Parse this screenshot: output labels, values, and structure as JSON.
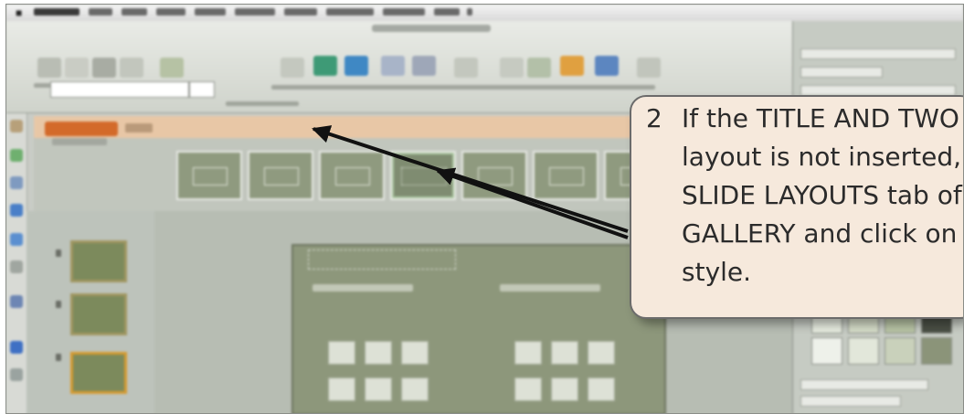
{
  "app": {
    "menu_icon": "apple-icon"
  },
  "toolbar": {
    "font_field": "",
    "size_field": ""
  },
  "ribbon": {
    "active_tab": "",
    "gallery_layouts": [
      "layout-1",
      "layout-2",
      "layout-3",
      "layout-4",
      "layout-5",
      "layout-6",
      "layout-7"
    ]
  },
  "callout": {
    "number": "2",
    "lines": [
      "If the TITLE AND TWO",
      "layout is not inserted,",
      "SLIDE LAYOUTS tab of",
      "GALLERY and click on",
      "style."
    ]
  },
  "colors": {
    "callout_bg": "#f6e9dc",
    "accent_tab": "#d36a2a",
    "arrow": "#111111"
  }
}
